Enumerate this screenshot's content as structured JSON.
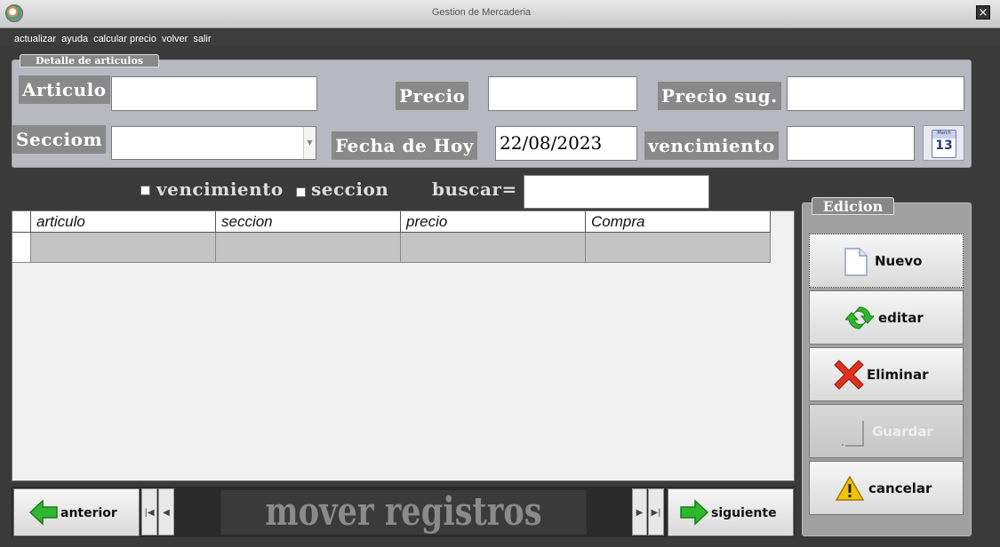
{
  "window": {
    "title": "Gestion de Mercaderia",
    "close_label": "×"
  },
  "menu": [
    "actualizar",
    "ayuda",
    "calcular precio",
    "volver",
    "salir"
  ],
  "detail": {
    "tab_label": "Detalle de articulos",
    "articulo_label": "Articulo",
    "articulo_value": "",
    "precio_label": "Precio",
    "precio_value": "",
    "precio_sug_label": "Precio sug.",
    "precio_sug_value": "",
    "seccion_label": "Secciom",
    "seccion_value": "",
    "fecha_label": "Fecha de Hoy",
    "fecha_value": "22/08/2023",
    "vencimiento_label": "vencimiento",
    "vencimiento_value": ""
  },
  "calendar": {
    "month": "March",
    "day": "13"
  },
  "filters": {
    "vencimiento_label": "vencimiento",
    "seccion_label": "seccion",
    "buscar_label": "buscar=",
    "buscar_value": ""
  },
  "grid": {
    "columns": [
      "articulo",
      "seccion",
      "precio",
      "Compra"
    ],
    "rows": [
      [
        "",
        "",
        "",
        ""
      ]
    ]
  },
  "edicion": {
    "tab_label": "Edicion",
    "buttons": [
      {
        "label": "Nuevo",
        "icon": "new-document-icon",
        "enabled": true
      },
      {
        "label": "editar",
        "icon": "refresh-icon",
        "enabled": true
      },
      {
        "label": "Eliminar",
        "icon": "delete-x-icon",
        "enabled": true
      },
      {
        "label": "Guardar",
        "icon": "save-icon",
        "enabled": false
      },
      {
        "label": "cancelar",
        "icon": "warning-icon",
        "enabled": true
      }
    ]
  },
  "navigation": {
    "anterior_label": "anterior",
    "siguiente_label": "siguiente",
    "center_label": "mover registros",
    "first_glyph": "|◀",
    "prev_glyph": "◀",
    "next_glyph": "▶",
    "last_glyph": "▶|"
  },
  "colors": {
    "accent_green": "#2db82d",
    "delete_red": "#e0301e",
    "warning_yellow": "#f5c400"
  }
}
